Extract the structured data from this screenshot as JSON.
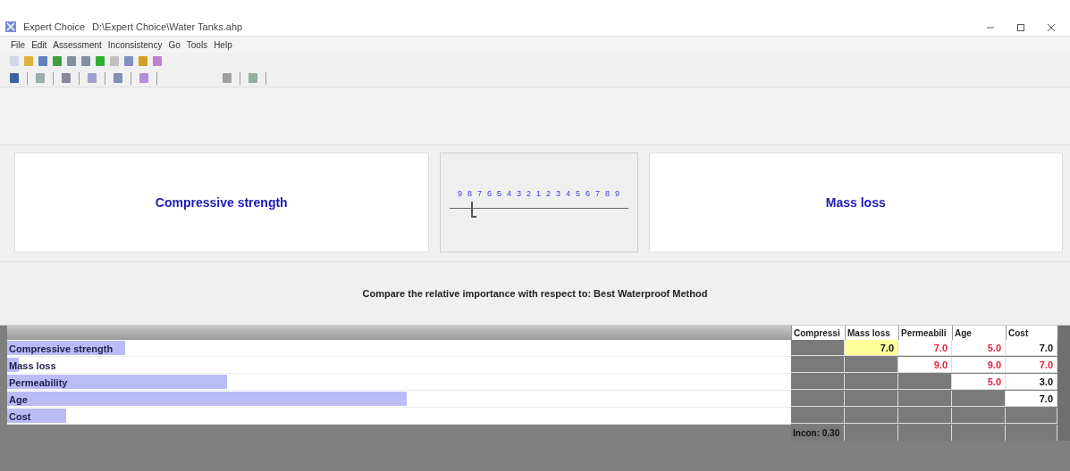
{
  "window": {
    "app": "Expert Choice",
    "file": "D:\\Expert Choice\\Water Tanks.ahp"
  },
  "menu": [
    {
      "label": "File"
    },
    {
      "label": "Edit"
    },
    {
      "label": "Assessment"
    },
    {
      "label": "Inconsistency"
    },
    {
      "label": "Go"
    },
    {
      "label": "Tools"
    },
    {
      "label": "Help"
    }
  ],
  "comparison": {
    "left": "Compressive strength",
    "right": "Mass loss",
    "scale": [
      "9",
      "8",
      "7",
      "6",
      "5",
      "4",
      "3",
      "2",
      "1",
      "2",
      "3",
      "4",
      "5",
      "6",
      "7",
      "8",
      "9"
    ],
    "level": 0.125,
    "prompt": "Compare the relative importance with respect to: Best Waterproof Method"
  },
  "matrix": {
    "columns": [
      "Compressi",
      "Mass loss",
      "Permeabili",
      "Age",
      "Cost"
    ],
    "rows": [
      {
        "label": "Compressive strength",
        "level": 0.15,
        "cells": [
          null,
          {
            "value": "7.0",
            "inverted": false,
            "selected": true
          },
          {
            "value": "7.0",
            "inverted": true,
            "selected": false
          },
          {
            "value": "5.0",
            "inverted": true,
            "selected": false
          },
          {
            "value": "7.0",
            "inverted": false,
            "selected": false
          }
        ]
      },
      {
        "label": "Mass loss",
        "level": 0.015,
        "cells": [
          null,
          null,
          {
            "value": "9.0",
            "inverted": true,
            "selected": false
          },
          {
            "value": "9.0",
            "inverted": true,
            "selected": false
          },
          {
            "value": "7.0",
            "inverted": true,
            "selected": false
          }
        ]
      },
      {
        "label": "Permeability",
        "level": 0.28,
        "cells": [
          null,
          null,
          null,
          {
            "value": "5.0",
            "inverted": true,
            "selected": false
          },
          {
            "value": "3.0",
            "inverted": false,
            "selected": false
          }
        ]
      },
      {
        "label": "Age",
        "level": 0.51,
        "cells": [
          null,
          null,
          null,
          null,
          {
            "value": "7.0",
            "inverted": false,
            "selected": false
          }
        ]
      },
      {
        "label": "Cost",
        "level": 0.075,
        "cells": [
          null,
          null,
          null,
          null,
          null
        ]
      }
    ],
    "inconsistency": "Incon: 0.30"
  }
}
